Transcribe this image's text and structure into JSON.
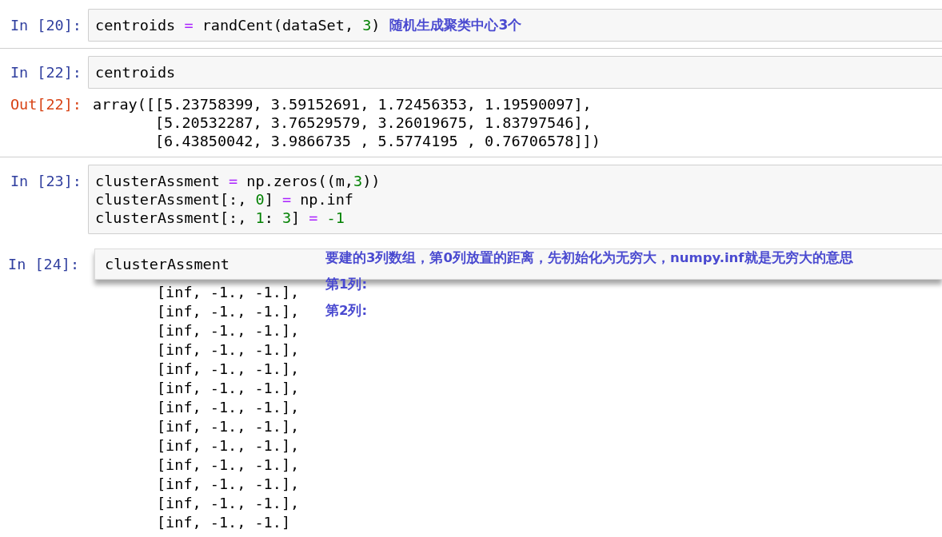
{
  "cells": [
    {
      "prompt": "In [20]:",
      "lines": [
        [
          {
            "t": "centroids ",
            "kind": "name"
          },
          {
            "t": "=",
            "kind": "op"
          },
          {
            "t": " randCent(dataSet, ",
            "kind": "name"
          },
          {
            "t": "3",
            "kind": "num"
          },
          {
            "t": ")",
            "kind": "name"
          }
        ]
      ],
      "note": "随机生成聚类中心3个",
      "divider": true
    },
    {
      "prompt": "In [22]:",
      "lines": [
        [
          {
            "t": "centroids",
            "kind": "name"
          }
        ]
      ],
      "out_prompt": "Out[22]:",
      "output": [
        "array([[5.23758399, 3.59152691, 1.72456353, 1.19590097],",
        "       [5.20532287, 3.76529579, 3.26019675, 1.83797546],",
        "       [6.43850042, 3.9866735 , 5.5774195 , 0.76706578]])"
      ],
      "divider": true
    },
    {
      "prompt": "In [23]:",
      "lines": [
        [
          {
            "t": "clusterAssment ",
            "kind": "name"
          },
          {
            "t": "=",
            "kind": "op"
          },
          {
            "t": " np.zeros((m,",
            "kind": "name"
          },
          {
            "t": "3",
            "kind": "num"
          },
          {
            "t": "))",
            "kind": "name"
          }
        ],
        [
          {
            "t": "clusterAssment[:, ",
            "kind": "name"
          },
          {
            "t": "0",
            "kind": "num"
          },
          {
            "t": "] ",
            "kind": "name"
          },
          {
            "t": "=",
            "kind": "op"
          },
          {
            "t": " np.inf",
            "kind": "name"
          }
        ],
        [
          {
            "t": "clusterAssment[:, ",
            "kind": "name"
          },
          {
            "t": "1",
            "kind": "num"
          },
          {
            "t": ": ",
            "kind": "name"
          },
          {
            "t": "3",
            "kind": "num"
          },
          {
            "t": "] ",
            "kind": "name"
          },
          {
            "t": "=",
            "kind": "op"
          },
          {
            "t": " -1",
            "kind": "num"
          }
        ]
      ]
    }
  ],
  "pasted_cell": {
    "prompt": "In [24]:",
    "code": "clusterAssment",
    "notes": [
      "要建的3列数组，第0列放置的距离，先初始化为无穷大，numpy.inf就是无穷大的意思",
      "第1列:",
      "第2列:"
    ],
    "output": [
      "       [inf, -1., -1.],",
      "       [inf, -1., -1.],",
      "       [inf, -1., -1.],",
      "       [inf, -1., -1.],",
      "       [inf, -1., -1.],",
      "       [inf, -1., -1.],",
      "       [inf, -1., -1.],",
      "       [inf, -1., -1.],",
      "       [inf, -1., -1.],",
      "       [inf, -1., -1.],",
      "       [inf, -1., -1.],",
      "       [inf, -1., -1.],",
      "       [inf, -1., -1.]"
    ]
  }
}
